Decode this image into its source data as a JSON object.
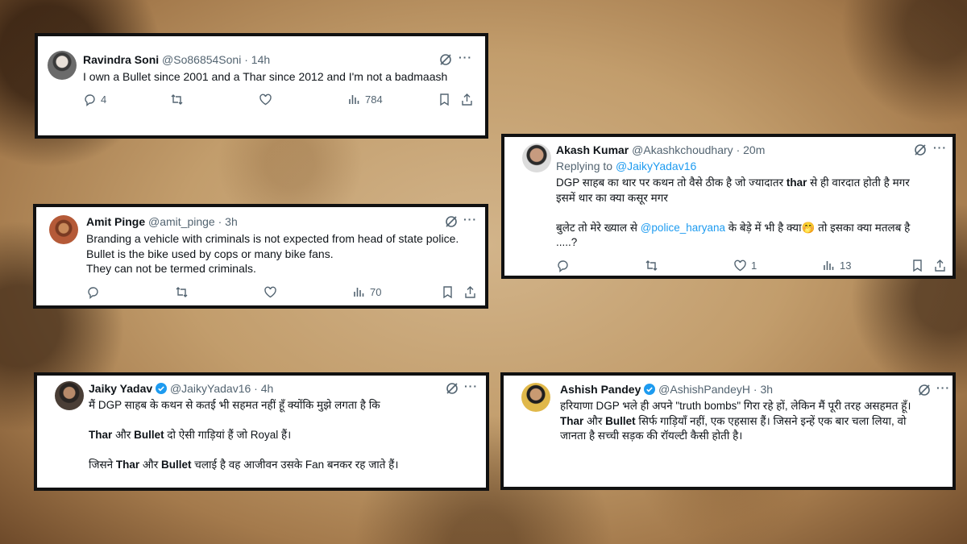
{
  "tweets": [
    {
      "name": "Ravindra Soni",
      "handle": "@So86854Soni",
      "time": "14h",
      "text": "I own a Bullet since 2001 and a Thar since 2012 and I'm not a badmaash",
      "replies": "4",
      "likes": "",
      "views": "784"
    },
    {
      "name": "Akash Kumar",
      "handle": "@Akashkchoudhary",
      "time": "20m",
      "replying_prefix": "Replying to",
      "replying_to": "@JaikyYadav16",
      "line1_a": "DGP साहब का थार पर कथन तो वैसे ठीक है जो ज्यादातर ",
      "line1_bold": "thar",
      "line1_b": " से ही वारदात होती है मगर",
      "line2": "इसमें थार का क्या कसूर मगर",
      "line3_a": "बुलेट तो मेरे ख्याल से ",
      "line3_mention": "@police_haryana",
      "line3_b": " के बेड़े में भी है क्या",
      "line3_emoji": "🤭",
      "line3_c": " तो इसका क्या मतलब है",
      "line4": ".....?",
      "likes": "1",
      "views": "13"
    },
    {
      "name": "Amit Pinge",
      "handle": "@amit_pinge",
      "time": "3h",
      "line1": "Branding a vehicle with criminals is not expected from head of state police.",
      "line2": "Bullet is the bike used by cops or many bike fans.",
      "line3": "They can not be termed criminals.",
      "views": "70"
    },
    {
      "name": "Jaiky Yadav",
      "handle": "@JaikyYadav16",
      "time": "4h",
      "line1": "मैं DGP साहब के कथन से कतई भी सहमत नहीं हूँ क्योंकि मुझे लगता है कि",
      "p2_bold1": "Thar",
      "p2_mid": " और ",
      "p2_bold2": "Bullet",
      "p2_end": " दो ऐसी गाड़ियां हैं जो Royal हैं।",
      "p3_a": "जिसने ",
      "p3_bold1": "Thar",
      "p3_mid": " और ",
      "p3_bold2": "Bullet",
      "p3_end": " चलाई है वह आजीवन उसके Fan बनकर रह जाते हैं।"
    },
    {
      "name": "Ashish Pandey",
      "handle": "@AshishPandeyH",
      "time": "3h",
      "line1": "हरियाणा DGP भले ही अपने \"truth bombs\" गिरा रहे हों, लेकिन मैं पूरी तरह असहमत हूँ।",
      "l2_bold1": "Thar",
      "l2_mid": " और ",
      "l2_bold2": "Bullet",
      "l2_end": " सिर्फ गाड़ियाँ नहीं, एक एहसास हैं। जिसने इन्हें एक बार चला लिया, वो",
      "line3": "जानता है सच्ची सड़क की रॉयल्टी कैसी होती है।"
    }
  ],
  "separator": "·",
  "more_label": "···",
  "colors": {
    "accent": "#1d9bf0",
    "muted": "#536471",
    "verified": "#1d9bf0"
  }
}
